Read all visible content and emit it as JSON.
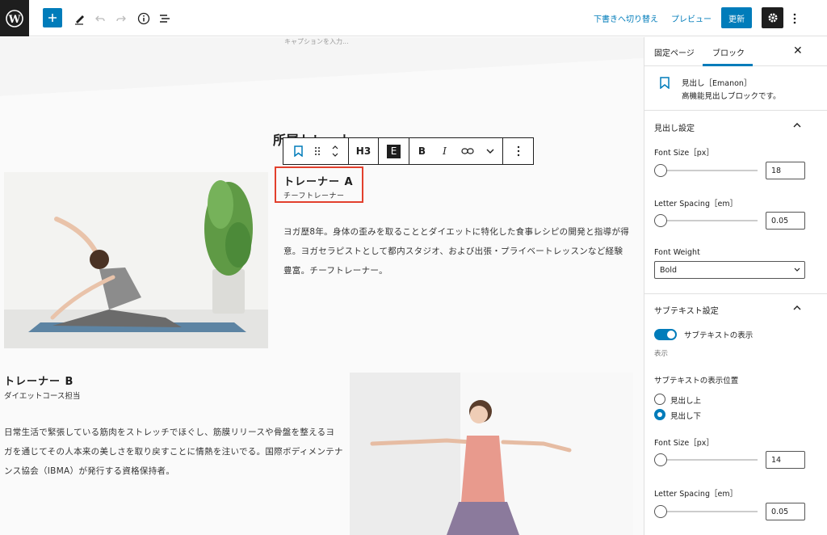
{
  "topbar": {
    "switch_draft": "下書きへ切り替え",
    "preview": "プレビュー",
    "update": "更新"
  },
  "canvas": {
    "caption_placeholder": "キャプションを入力...",
    "section_title": "所属トレーナー",
    "toolbar": {
      "heading_level": "H3",
      "emanon": "E",
      "bold": "B",
      "italic": "I"
    },
    "trainer_a": {
      "name": "トレーナー A",
      "role": "チーフトレーナー",
      "description": "ヨガ歴8年。身体の歪みを取ることとダイエットに特化した食事レシピの開発と指導が得意。ヨガセラピストとして都内スタジオ、および出張・プライベートレッスンなど経験豊富。チーフトレーナー。"
    },
    "trainer_b": {
      "name": "トレーナー B",
      "role": "ダイエットコース担当",
      "description": "日常生活で緊張している筋肉をストレッチでほぐし、筋膜リリースや骨盤を整えるヨガを通じてその人本来の美しさを取り戻すことに情熱を注いでる。国際ボディメンテナンス協会（IBMA）が発行する資格保持者。"
    }
  },
  "sidebar": {
    "tabs": [
      {
        "label": "固定ページ"
      },
      {
        "label": "ブロック"
      }
    ],
    "block_name": "見出し［Emanon］",
    "block_desc": "高機能見出しブロックです。",
    "heading_settings": {
      "title": "見出し設定",
      "font_size_label": "Font Size［px］",
      "font_size": "18",
      "font_size_value": 18,
      "letter_spacing_label": "Letter Spacing［em］",
      "letter_spacing": "0.05",
      "font_weight_label": "Font Weight",
      "font_weight": "Bold"
    },
    "subtext_settings": {
      "title": "サブテキスト設定",
      "toggle_label": "サブテキストの表示",
      "toggle_on": true,
      "toggle_help": "表示",
      "position_label": "サブテキストの表示位置",
      "options": [
        {
          "label": "見出し上",
          "selected": false
        },
        {
          "label": "見出し下",
          "selected": true
        }
      ],
      "font_size_label": "Font Size［px］",
      "font_size": "14",
      "letter_spacing_label": "Letter Spacing［em］",
      "letter_spacing": "0.05"
    }
  },
  "colors": {
    "accent": "#007cba",
    "dark": "#1e1e1e",
    "selection": "#e2402d"
  }
}
